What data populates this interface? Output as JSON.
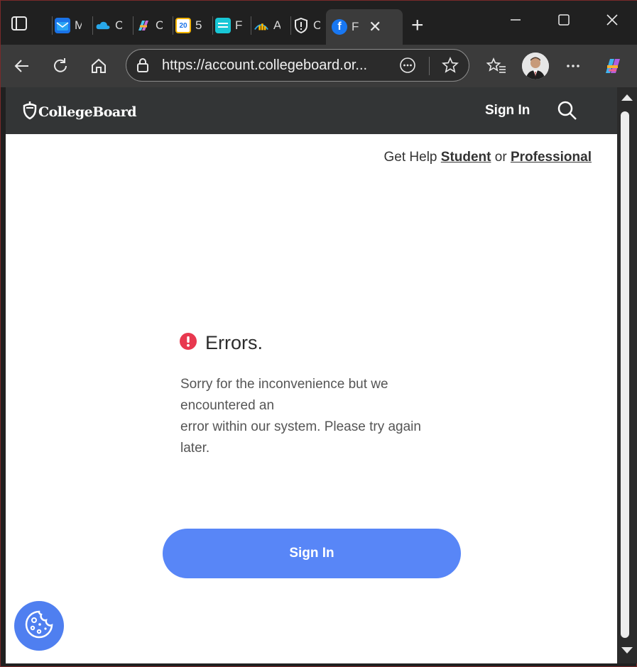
{
  "browser": {
    "tabs": [
      {
        "title": "M",
        "icon": "outlook-icon"
      },
      {
        "title": "C",
        "icon": "onedrive-icon"
      },
      {
        "title": "C",
        "icon": "copilot-icon"
      },
      {
        "title": "5",
        "icon": "calendar-icon"
      },
      {
        "title": "F",
        "icon": "forms-icon"
      },
      {
        "title": "A",
        "icon": "analytics-icon"
      },
      {
        "title": "C",
        "icon": "shield-icon"
      },
      {
        "title": "F",
        "icon": "facebook-icon"
      }
    ],
    "calendar_day": "20",
    "url": "https://account.collegeboard.or..."
  },
  "header": {
    "logo": "CollegeBoard",
    "sign_in": "Sign In"
  },
  "help": {
    "prefix": "Get Help",
    "student": "Student",
    "or": "or",
    "professional": "Professional"
  },
  "error": {
    "title": "Errors.",
    "line1": "Sorry for the inconvenience but we",
    "line2": "encountered an",
    "line3": "error within our system. Please try again",
    "line4": "later."
  },
  "main": {
    "sign_in_button": "Sign In"
  },
  "colors": {
    "header_bg": "#333536",
    "button_bg": "#5886f7",
    "error_icon": "#e8384f"
  }
}
